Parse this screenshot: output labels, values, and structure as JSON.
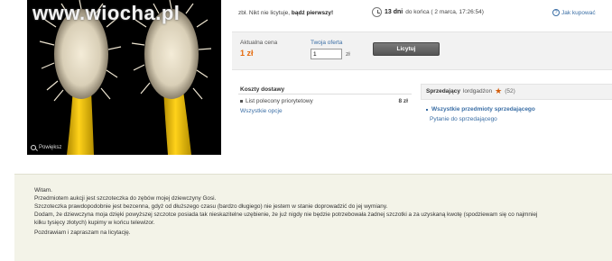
{
  "photo": {
    "watermark": "www.wiocha.pl",
    "zoom_label": "Powiększ",
    "icon": "magnifier-icon"
  },
  "auction": {
    "bids_prefix": "zbł. Nikt nie licytuje, ",
    "bids_cta": "bądź pierwszy!",
    "time_left": "13 dni",
    "end_text": " do końca ( 2 marca, 17:26:54)",
    "how_to_buy": "Jak kupować",
    "current_price_label": "Aktualna cena",
    "current_price": "1 zł",
    "your_offer_label": "Twoja oferta",
    "offer_value": "1",
    "offer_unit": "zł",
    "bid_button": "Licytuj"
  },
  "shipping": {
    "title": "Koszty dostawy",
    "option": "List polecony priorytetowy",
    "price": "8 zł",
    "all_options": "Wszystkie opcje"
  },
  "seller": {
    "label": "Sprzedający",
    "name": "lordgadżon",
    "rating": "(52)",
    "link_items": "Wszystkie przedmioty sprzedającego",
    "link_question": "Pytanie do sprzedającego"
  },
  "description": {
    "lines": [
      "Witam.",
      "Przedmiotem aukcji jest szczoteczka do zębów mojej dziewczyny Gosi.",
      "Szczoteczka prawdopodobnie jest bezcenna, gdyż od dłuższego czasu (bardzo długiego) nie jestem w stanie doprowadzić do jej wymiany.",
      "Dodam, że dziewczyna moja dzięki powyższej szczotce posiada tak nieskazitelne uzębienie, że już nigdy nie będzie potrzebowała żadnej szczotki a za uzyskaną kwotę (spodziewam się co najmniej",
      "kilku tysięcy złotych) kupimy w końcu telewizor.",
      "Pozdrawiam i zapraszam na licytację."
    ]
  },
  "colors": {
    "price": "#e56b0f",
    "link": "#3a6ea5",
    "description_bg": "#f3f3e8"
  }
}
